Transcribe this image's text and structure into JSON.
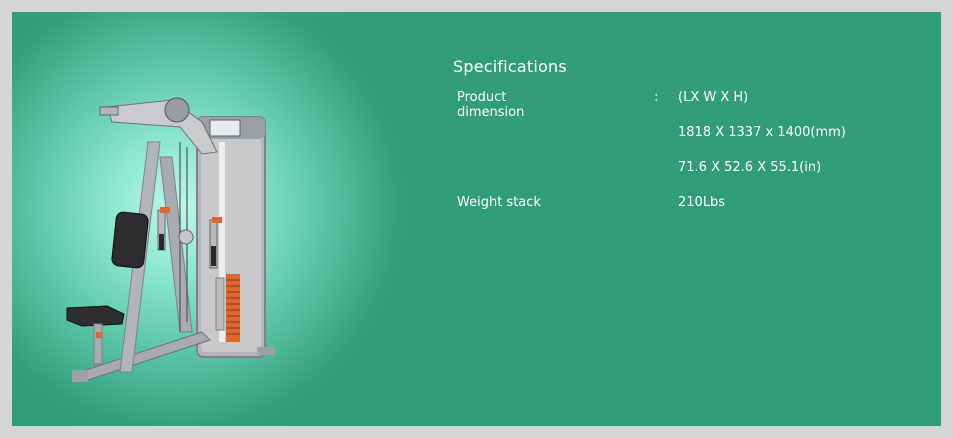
{
  "specifications": {
    "title": "Specifications",
    "rows": [
      {
        "label": "Product dimension",
        "colon": ":",
        "value": "(LX W X H)"
      },
      {
        "label": "",
        "colon": "",
        "value": "1818 X 1337 x 1400(mm)"
      },
      {
        "label": "",
        "colon": "",
        "value": "71.6 X 52.6 X 55.1(in)"
      },
      {
        "label": "Weight stack",
        "colon": "",
        "value": "210Lbs"
      }
    ]
  },
  "colors": {
    "panel": "#319c79",
    "glow": "#bff7e7",
    "border": "#d6d6d6",
    "text": "#ffffff"
  }
}
